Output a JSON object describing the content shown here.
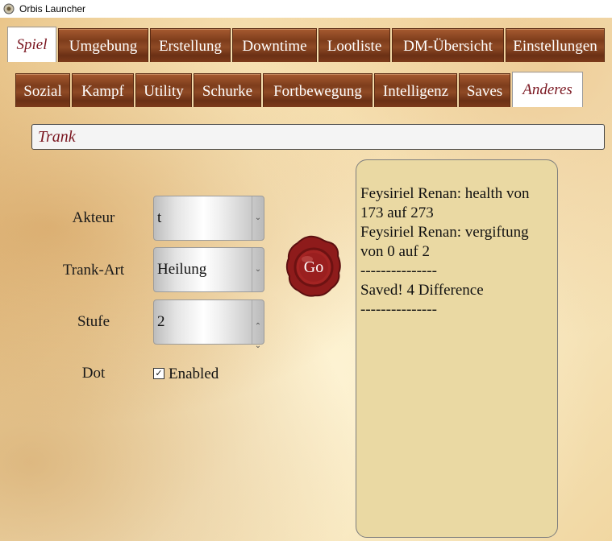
{
  "window": {
    "title": "Orbis Launcher"
  },
  "main_tabs": [
    {
      "label": "Spiel",
      "active": true
    },
    {
      "label": "Umgebung",
      "active": false
    },
    {
      "label": "Erstellung",
      "active": false
    },
    {
      "label": "Downtime",
      "active": false
    },
    {
      "label": "Lootliste",
      "active": false
    },
    {
      "label": "DM-Übersicht",
      "active": false
    },
    {
      "label": "Einstellungen",
      "active": false
    }
  ],
  "sub_tabs": [
    {
      "label": "Sozial",
      "active": false
    },
    {
      "label": "Kampf",
      "active": false
    },
    {
      "label": "Utility",
      "active": false
    },
    {
      "label": "Schurke",
      "active": false
    },
    {
      "label": "Fortbewegung",
      "active": false
    },
    {
      "label": "Intelligenz",
      "active": false
    },
    {
      "label": "Saves",
      "active": false
    },
    {
      "label": "Anderes",
      "active": true
    }
  ],
  "search": {
    "value": "Trank"
  },
  "form": {
    "actor_label": "Akteur",
    "actor_value": "t",
    "potion_type_label": "Trank-Art",
    "potion_type_value": "Heilung",
    "level_label": "Stufe",
    "level_value": "2",
    "dot_label": "Dot",
    "dot_checkbox_label": "Enabled",
    "dot_checked": true
  },
  "go_button": {
    "label": "Go"
  },
  "output": {
    "lines": [
      "Feysiriel Renan: health von 173 auf 273",
      "Feysiriel Renan: vergiftung von 0 auf 2",
      "---------------",
      "Saved! 4 Difference",
      "---------------"
    ]
  },
  "colors": {
    "tab_wood": "#7e3d1c",
    "active_tab_text": "#7a1620",
    "output_bg": "#ead9a3",
    "wax_seal": "#8e1b1b"
  },
  "icons": {
    "app": "app-icon",
    "dropdown": "chevron-down-icon",
    "spin_up": "chevron-up-icon",
    "spin_down": "chevron-down-icon",
    "checkbox": "checkmark-icon"
  }
}
